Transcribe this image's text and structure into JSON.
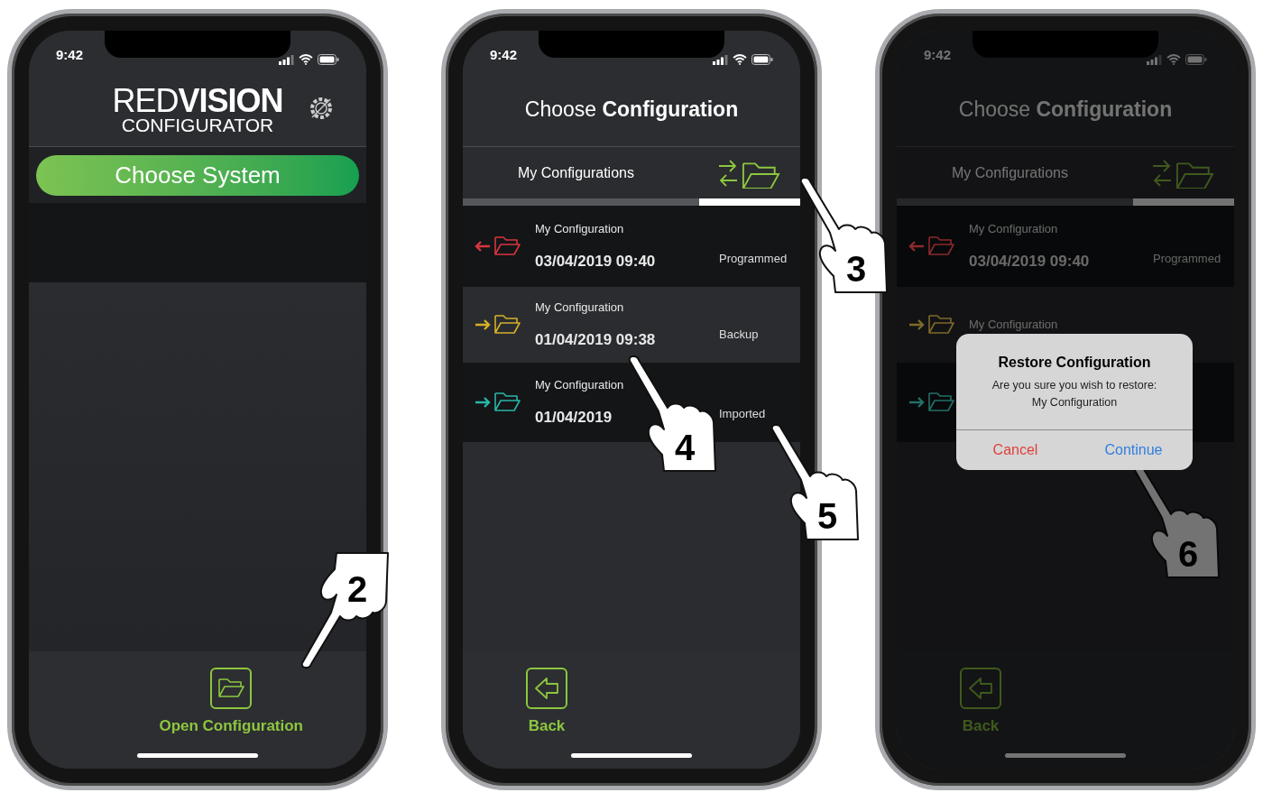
{
  "phones": [
    {
      "kind": "home",
      "dimmed": false,
      "status_time": "9:42",
      "logo": {
        "title": "RED**VISION**",
        "subtitle": "CONFIGURATOR"
      },
      "primary_button": "Choose System",
      "bottom_action": "Open Configuration",
      "hands": [
        "2"
      ]
    },
    {
      "kind": "list",
      "dimmed": false,
      "status_time": "9:42",
      "title": "Choose **Configuration**",
      "tabs": [
        {
          "kind": "text",
          "label": "My Configurations",
          "selected": false
        },
        {
          "kind": "transfer",
          "selected": true
        }
      ],
      "rows": [
        {
          "kind": "outgoing",
          "color": "#d9343c",
          "title": "My Configuration",
          "date": "03/04/2019 09:40",
          "status": "Programmed"
        },
        {
          "kind": "incoming",
          "color": "#d4b02a",
          "title": "My Configuration",
          "date": "01/04/2019 09:38",
          "status": "Backup"
        },
        {
          "kind": "incoming",
          "color": "#2bb5a8",
          "title": "My Configuration",
          "date": "01/04/2019",
          "status": "Imported"
        }
      ],
      "back": "Back",
      "hands": [
        "3",
        "4",
        "5"
      ]
    },
    {
      "kind": "list",
      "dimmed": true,
      "status_time": "9:42",
      "title": "Choose **Configuration**",
      "tabs": [
        {
          "kind": "text",
          "label": "My Configurations",
          "selected": false
        },
        {
          "kind": "transfer",
          "selected": true
        }
      ],
      "rows": [
        {
          "kind": "outgoing",
          "color": "#8a2a2e",
          "title": "My Configuration",
          "date": "03/04/2019 09:40",
          "status": "Programmed"
        },
        {
          "kind": "incoming",
          "color": "#7d6a28",
          "title": "My Configuration"
        },
        {
          "kind": "incoming",
          "color": "#22706a"
        }
      ],
      "back": "Back",
      "dialog": {
        "title": "Restore Configuration",
        "message_lines": [
          "Are you sure you wish to restore:",
          "My Configuration"
        ],
        "buttons": [
          {
            "kind": "destructive",
            "label": "Cancel"
          },
          {
            "kind": "default",
            "label": "Continue"
          }
        ]
      },
      "hands": [
        "6"
      ]
    }
  ]
}
